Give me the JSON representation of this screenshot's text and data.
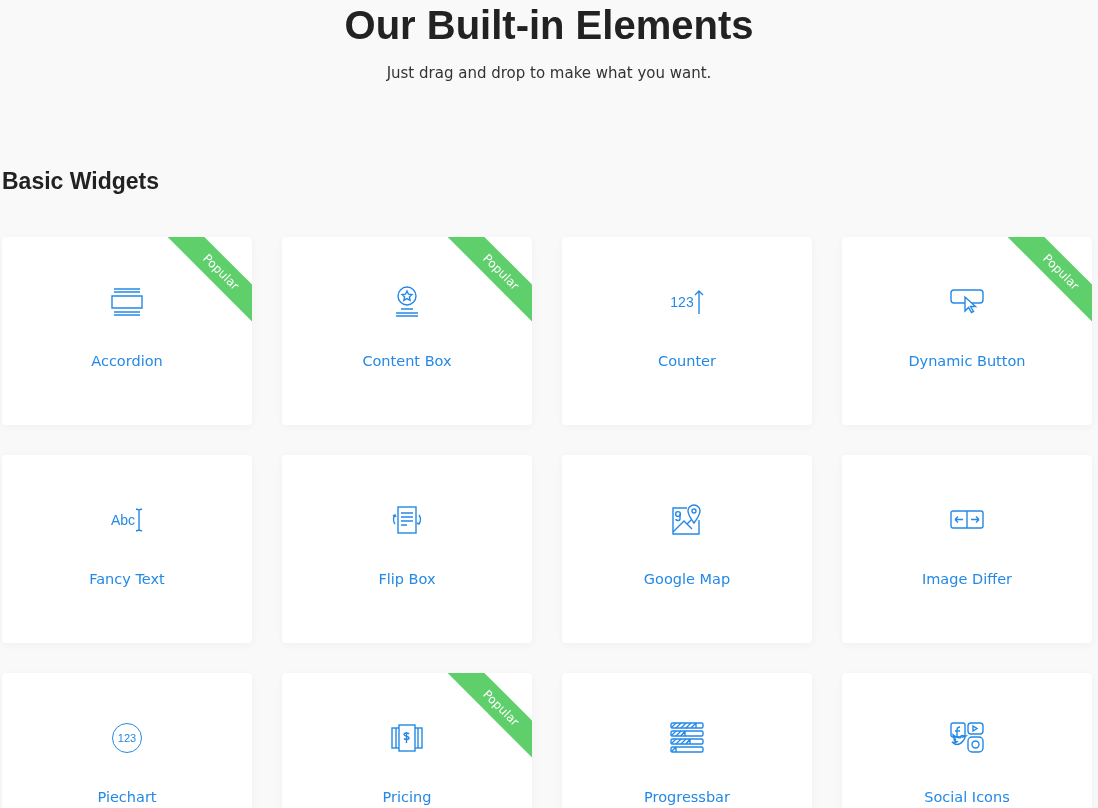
{
  "header": {
    "title": "Our Built-in Elements",
    "subtitle": "Just drag and drop to make what you want."
  },
  "section": {
    "title": "Basic Widgets"
  },
  "widgets": [
    {
      "label": "Accordion",
      "kind": "accordion",
      "ribbon": "Popular"
    },
    {
      "label": "Content Box",
      "kind": "contentbox",
      "ribbon": "Popular"
    },
    {
      "label": "Counter",
      "kind": "counter",
      "icon_text": "123"
    },
    {
      "label": "Dynamic Button",
      "kind": "button",
      "ribbon": "Popular"
    },
    {
      "label": "Fancy Text",
      "kind": "fancytext",
      "icon_text": "Abc"
    },
    {
      "label": "Flip Box",
      "kind": "flipbox"
    },
    {
      "label": "Google Map",
      "kind": "map"
    },
    {
      "label": "Image Differ",
      "kind": "differ"
    },
    {
      "label": "Piechart",
      "kind": "piechart",
      "icon_text": "123"
    },
    {
      "label": "Pricing",
      "kind": "pricing",
      "ribbon": "Popular"
    },
    {
      "label": "Progressbar",
      "kind": "progressbar"
    },
    {
      "label": "Social Icons",
      "kind": "social"
    }
  ]
}
